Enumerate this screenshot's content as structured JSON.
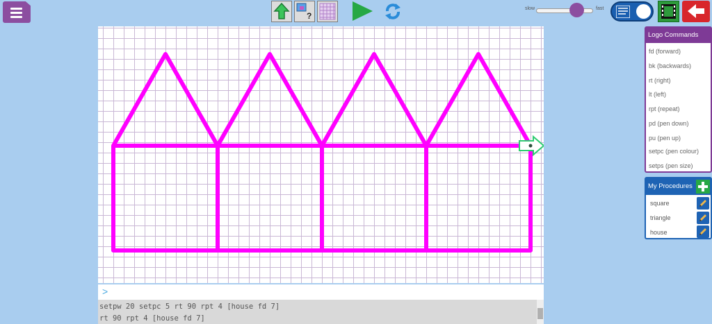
{
  "toolbar": {
    "speed_slow_label": "slow",
    "speed_fast_label": "fast",
    "speed_value": 0.72
  },
  "console": {
    "history": [
      "setpw 20 setpc 5 rt 90 rpt 4 [house fd 7]",
      "rt 90 rpt 4 [house fd 7]"
    ],
    "prompt_symbol": ">"
  },
  "commands": {
    "title": "Logo Commands",
    "items": [
      "fd (forward)",
      "bk (backwards)",
      "rt (right)",
      "lt (left)",
      "rpt (repeat)",
      "pd (pen down)",
      "pu (pen up)",
      "setpc (pen colour)",
      "setps (pen size)"
    ]
  },
  "procedures": {
    "title": "My Procedures",
    "items": [
      "square",
      "triangle",
      "house"
    ]
  },
  "colors": {
    "pen": "#ff00ff",
    "turtle": "#2ecc71",
    "accent_purple": "#7e3a96",
    "accent_blue": "#1e63b4"
  }
}
